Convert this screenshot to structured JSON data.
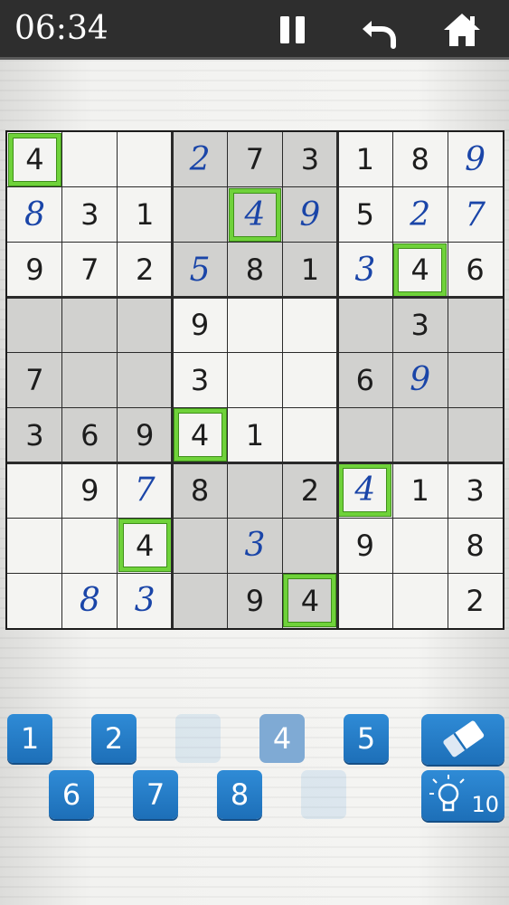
{
  "status_bar": {
    "time": "06:34"
  },
  "toolbar": {
    "icons": [
      "pause-icon",
      "undo-icon",
      "home-icon"
    ]
  },
  "board": {
    "cells": [
      [
        {
          "v": "4",
          "t": "g",
          "h": 1
        },
        {
          "v": "",
          "t": "g"
        },
        {
          "v": "",
          "t": "g"
        },
        {
          "v": "2",
          "t": "u"
        },
        {
          "v": "7",
          "t": "g"
        },
        {
          "v": "3",
          "t": "g"
        },
        {
          "v": "1",
          "t": "g"
        },
        {
          "v": "8",
          "t": "g"
        },
        {
          "v": "9",
          "t": "u"
        }
      ],
      [
        {
          "v": "8",
          "t": "u"
        },
        {
          "v": "3",
          "t": "g"
        },
        {
          "v": "1",
          "t": "g"
        },
        {
          "v": "",
          "t": "g"
        },
        {
          "v": "4",
          "t": "u",
          "h": 1
        },
        {
          "v": "9",
          "t": "u"
        },
        {
          "v": "5",
          "t": "g"
        },
        {
          "v": "2",
          "t": "u"
        },
        {
          "v": "7",
          "t": "u"
        }
      ],
      [
        {
          "v": "9",
          "t": "g"
        },
        {
          "v": "7",
          "t": "g"
        },
        {
          "v": "2",
          "t": "g"
        },
        {
          "v": "5",
          "t": "u"
        },
        {
          "v": "8",
          "t": "g"
        },
        {
          "v": "1",
          "t": "g"
        },
        {
          "v": "3",
          "t": "u"
        },
        {
          "v": "4",
          "t": "g",
          "h": 1
        },
        {
          "v": "6",
          "t": "g"
        }
      ],
      [
        {
          "v": "",
          "t": "g"
        },
        {
          "v": "",
          "t": "g"
        },
        {
          "v": "",
          "t": "g"
        },
        {
          "v": "9",
          "t": "g"
        },
        {
          "v": "",
          "t": "g"
        },
        {
          "v": "",
          "t": "g"
        },
        {
          "v": "",
          "t": "g"
        },
        {
          "v": "3",
          "t": "g"
        },
        {
          "v": "",
          "t": "g"
        }
      ],
      [
        {
          "v": "7",
          "t": "g"
        },
        {
          "v": "",
          "t": "g"
        },
        {
          "v": "",
          "t": "g"
        },
        {
          "v": "3",
          "t": "g"
        },
        {
          "v": "",
          "t": "g"
        },
        {
          "v": "",
          "t": "g"
        },
        {
          "v": "6",
          "t": "g"
        },
        {
          "v": "9",
          "t": "u"
        },
        {
          "v": "",
          "t": "g"
        }
      ],
      [
        {
          "v": "3",
          "t": "g"
        },
        {
          "v": "6",
          "t": "g"
        },
        {
          "v": "9",
          "t": "g"
        },
        {
          "v": "4",
          "t": "g",
          "h": 1
        },
        {
          "v": "1",
          "t": "g"
        },
        {
          "v": "",
          "t": "g"
        },
        {
          "v": "",
          "t": "g"
        },
        {
          "v": "",
          "t": "g"
        },
        {
          "v": "",
          "t": "g"
        }
      ],
      [
        {
          "v": "",
          "t": "g"
        },
        {
          "v": "9",
          "t": "g"
        },
        {
          "v": "7",
          "t": "u"
        },
        {
          "v": "8",
          "t": "g"
        },
        {
          "v": "",
          "t": "g"
        },
        {
          "v": "2",
          "t": "g"
        },
        {
          "v": "4",
          "t": "u",
          "h": 1
        },
        {
          "v": "1",
          "t": "g"
        },
        {
          "v": "3",
          "t": "g"
        }
      ],
      [
        {
          "v": "",
          "t": "g"
        },
        {
          "v": "",
          "t": "g"
        },
        {
          "v": "4",
          "t": "g",
          "h": 1
        },
        {
          "v": "",
          "t": "g"
        },
        {
          "v": "3",
          "t": "u"
        },
        {
          "v": "",
          "t": "g"
        },
        {
          "v": "9",
          "t": "g"
        },
        {
          "v": "",
          "t": "g"
        },
        {
          "v": "8",
          "t": "g"
        }
      ],
      [
        {
          "v": "",
          "t": "g"
        },
        {
          "v": "8",
          "t": "u"
        },
        {
          "v": "3",
          "t": "u"
        },
        {
          "v": "",
          "t": "g"
        },
        {
          "v": "9",
          "t": "g"
        },
        {
          "v": "4",
          "t": "g",
          "h": 1
        },
        {
          "v": "",
          "t": "g"
        },
        {
          "v": "",
          "t": "g"
        },
        {
          "v": "2",
          "t": "g"
        }
      ]
    ],
    "highlighted_digit": "4"
  },
  "number_pad": {
    "row1": [
      {
        "label": "1",
        "state": "active"
      },
      {
        "label": "2",
        "state": "active"
      },
      {
        "label": "",
        "state": "ghost"
      },
      {
        "label": "4",
        "state": "selected"
      },
      {
        "label": "5",
        "state": "active"
      }
    ],
    "row2": [
      {
        "label": "6",
        "state": "active"
      },
      {
        "label": "7",
        "state": "active"
      },
      {
        "label": "8",
        "state": "active"
      },
      {
        "label": "",
        "state": "ghost"
      }
    ]
  },
  "tools": {
    "eraser_icon": "eraser-icon",
    "hint_icon": "lightbulb-icon",
    "hint_count": "10"
  },
  "colors": {
    "user_digit": "#1a45a8",
    "highlight": "#6fd23a",
    "button": "#2379c4"
  }
}
